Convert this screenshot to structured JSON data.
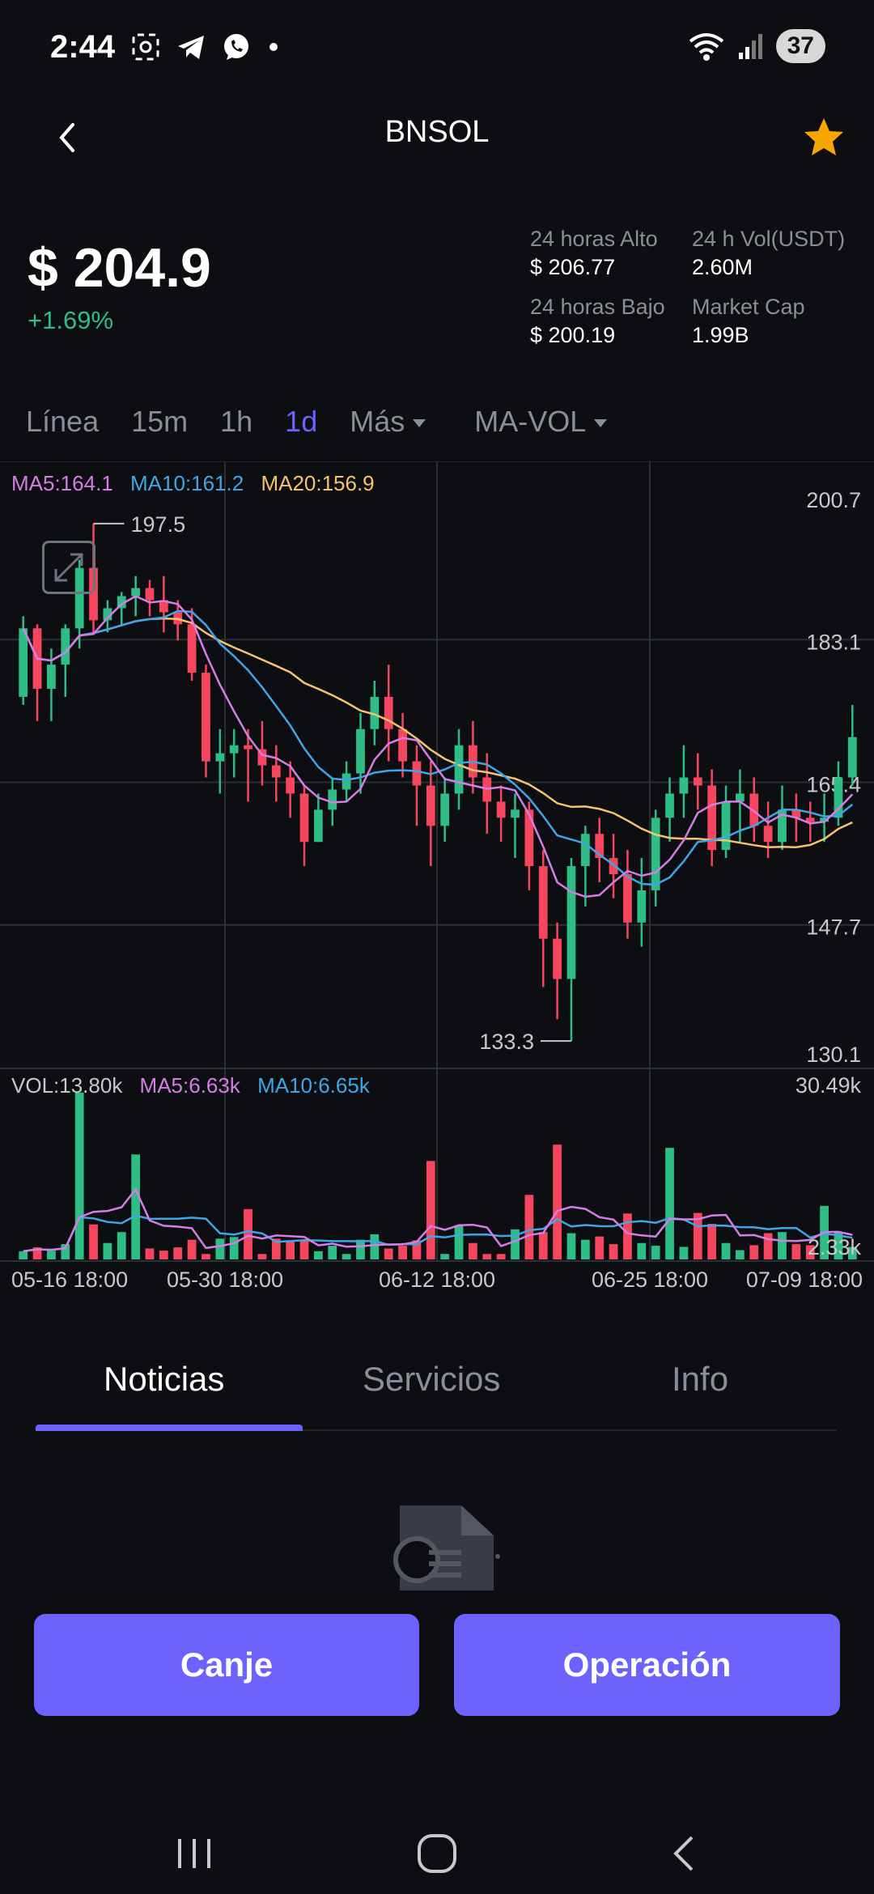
{
  "status_bar": {
    "time": "2:44",
    "battery": "37"
  },
  "header": {
    "title": "BNSOL"
  },
  "price": {
    "value": "$ 204.9",
    "change": "+1.69%"
  },
  "stats": {
    "high_label": "24 horas Alto",
    "high_value": "$ 206.77",
    "vol_label": "24 h Vol(USDT)",
    "vol_value": "2.60M",
    "low_label": "24 horas Bajo",
    "low_value": "$ 200.19",
    "cap_label": "Market Cap",
    "cap_value": "1.99B"
  },
  "timeframes": {
    "line": "Línea",
    "m15": "15m",
    "h1": "1h",
    "d1": "1d",
    "more": "Más",
    "indicator": "MA-VOL"
  },
  "chart_legend": {
    "ma5": "MA5:164.1",
    "ma10": "MA10:161.2",
    "ma20": "MA20:156.9"
  },
  "volume_legend": {
    "vol": "VOL:13.80k",
    "ma5": "MA5:6.63k",
    "ma10": "MA10:6.65k"
  },
  "colors": {
    "up": "#2ebd85",
    "down": "#f6465d",
    "ma5": "#d57ce6",
    "ma10": "#3ea6e8",
    "ma20": "#f6c26b",
    "accent": "#6c63ff",
    "star": "#f7a600"
  },
  "chart_data": {
    "type": "candlestick",
    "y_axis_labels": [
      "200.7",
      "183.1",
      "165.4",
      "147.7",
      "130.1"
    ],
    "ylim": [
      130.1,
      200.7
    ],
    "x_labels": [
      "05-16 18:00",
      "05-30 18:00",
      "06-12 18:00",
      "06-25 18:00",
      "07-09 18:00"
    ],
    "max_label": "197.5",
    "min_label": "133.3",
    "volume_axis_labels": [
      "30.49k",
      "2.33k"
    ],
    "candles": [
      [
        176,
        184.5,
        186,
        175
      ],
      [
        184.5,
        177,
        185,
        173
      ],
      [
        177,
        180,
        182,
        173
      ],
      [
        180,
        184.5,
        185,
        176
      ],
      [
        184.5,
        192,
        193,
        182
      ],
      [
        192,
        185.5,
        197.5,
        184
      ],
      [
        185.5,
        187,
        188,
        184
      ],
      [
        187,
        188.5,
        189,
        185
      ],
      [
        188.5,
        189.5,
        191,
        186
      ],
      [
        189.5,
        188,
        190.5,
        186
      ],
      [
        188,
        186.5,
        191,
        184
      ],
      [
        186.5,
        185,
        188,
        183
      ],
      [
        185,
        179,
        187,
        178
      ],
      [
        179,
        168,
        180,
        166
      ],
      [
        168,
        169,
        172,
        164
      ],
      [
        169,
        170,
        172,
        166
      ],
      [
        170,
        169.5,
        172,
        163
      ],
      [
        169.5,
        167.5,
        173,
        165
      ],
      [
        167.5,
        166,
        170,
        163
      ],
      [
        166,
        164,
        168,
        161
      ],
      [
        164,
        158,
        165,
        155
      ],
      [
        158,
        162,
        164,
        158
      ],
      [
        162,
        164.5,
        166,
        160
      ],
      [
        164.5,
        166.5,
        168,
        163
      ],
      [
        166.5,
        172,
        174,
        164
      ],
      [
        172,
        176,
        178,
        170
      ],
      [
        176,
        172,
        180,
        168
      ],
      [
        172,
        168,
        174,
        166
      ],
      [
        168,
        165,
        170,
        160
      ],
      [
        165,
        160,
        168,
        155
      ],
      [
        160,
        164,
        166,
        158
      ],
      [
        164,
        170,
        172,
        162
      ],
      [
        170,
        166,
        173,
        164
      ],
      [
        166,
        163,
        169,
        159
      ],
      [
        163,
        161,
        165,
        158
      ],
      [
        161,
        162,
        164,
        156
      ],
      [
        162,
        155,
        163,
        152
      ],
      [
        155,
        146,
        157,
        140
      ],
      [
        146,
        141,
        148,
        136
      ],
      [
        141,
        155,
        156,
        133.3
      ],
      [
        155,
        159,
        160,
        150
      ],
      [
        159,
        156,
        161,
        153
      ],
      [
        156,
        154,
        159,
        151
      ],
      [
        154,
        148,
        157,
        146
      ],
      [
        148,
        152,
        156,
        145
      ],
      [
        152,
        161,
        162,
        150
      ],
      [
        161,
        164,
        166,
        158
      ],
      [
        164,
        166,
        170,
        161
      ],
      [
        166,
        165,
        169,
        162
      ],
      [
        165,
        157,
        167,
        155
      ],
      [
        157,
        163,
        165,
        156
      ],
      [
        163,
        164,
        167,
        158
      ],
      [
        164,
        160,
        166,
        158
      ],
      [
        160,
        158,
        163,
        156
      ],
      [
        158,
        162,
        165,
        157
      ],
      [
        162,
        161,
        164,
        158
      ],
      [
        161,
        160.5,
        163,
        158
      ],
      [
        160.5,
        161,
        164,
        158
      ],
      [
        161,
        166,
        168,
        160
      ],
      [
        166,
        171,
        175,
        165
      ]
    ],
    "volumes": [
      1.5,
      2.2,
      1.6,
      2.8,
      30.5,
      6.4,
      3.0,
      5.0,
      19.2,
      2.0,
      1.6,
      2.2,
      3.6,
      1.0,
      3.8,
      4.1,
      9.2,
      1.0,
      3.8,
      3.2,
      3.4,
      1.5,
      2.5,
      1.0,
      3.6,
      4.6,
      2.0,
      2.5,
      3.5,
      18.0,
      1.0,
      6.2,
      3.0,
      1.0,
      1.0,
      5.5,
      11.8,
      5.0,
      21.0,
      4.8,
      3.6,
      4.2,
      2.8,
      8.4,
      3.0,
      2.5,
      20.4,
      2.3,
      8.5,
      6.5,
      3.0,
      1.7,
      2.6,
      4.8,
      5.0,
      2.8,
      2.6,
      9.8,
      5.0,
      2.3
    ]
  },
  "content_tabs": {
    "news": "Noticias",
    "services": "Servicios",
    "info": "Info"
  },
  "actions": {
    "swap": "Canje",
    "trade": "Operación"
  },
  "icons": {
    "back": "chevron-left-icon",
    "star": "star-icon",
    "expand": "expand-icon",
    "empty": "empty-document-icon",
    "nav_recent": "recent-apps-icon",
    "nav_home": "home-icon",
    "nav_back": "back-icon"
  }
}
